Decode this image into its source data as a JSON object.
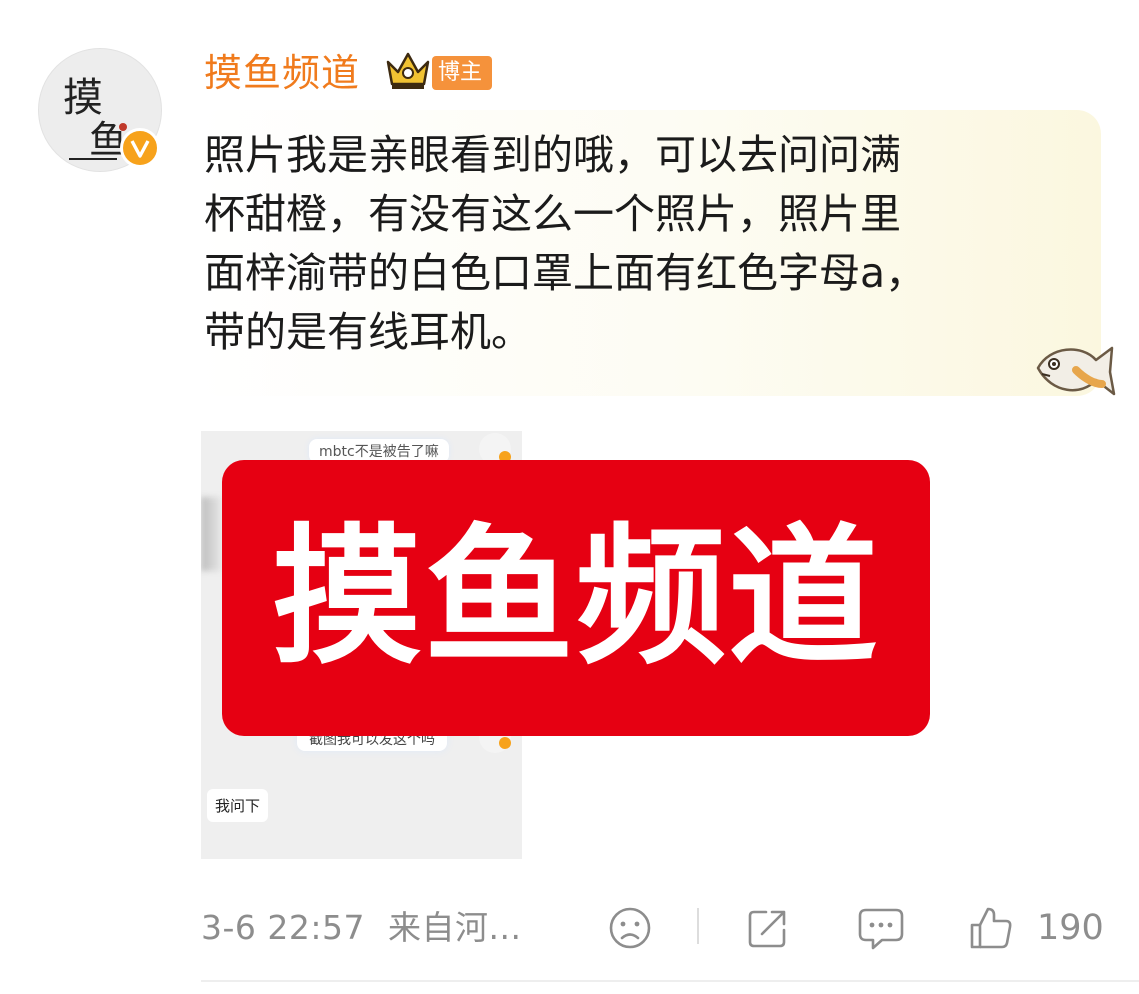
{
  "author": {
    "name": "摸鱼频道",
    "role_badge": "博主",
    "avatar_glyphs": "摸鱼",
    "verified_mark": "V"
  },
  "comment": {
    "text": "照片我是亲眼看到的哦，可以去问问满\n杯甜橙，有没有这么一个照片，照片里\n面梓渝带的白色口罩上面有红色字母a，\n带的是有线耳机。"
  },
  "attachment": {
    "chat_top_message": "mbtc不是被告了嘛",
    "chat_obscured_message": "截图我可以发这个吗",
    "chat_reply": "我问下",
    "watermark_text": "摸鱼频道"
  },
  "footer": {
    "timestamp": "3-6 22:57",
    "source": "来自河...",
    "like_count": "190",
    "icons": [
      "sad-face-icon",
      "share-icon",
      "comment-icon",
      "thumbs-up-icon"
    ]
  },
  "colors": {
    "username": "#f07b1d",
    "badge": "#f5923b",
    "watermark": "#e60012",
    "muted": "#8d8d8d"
  }
}
